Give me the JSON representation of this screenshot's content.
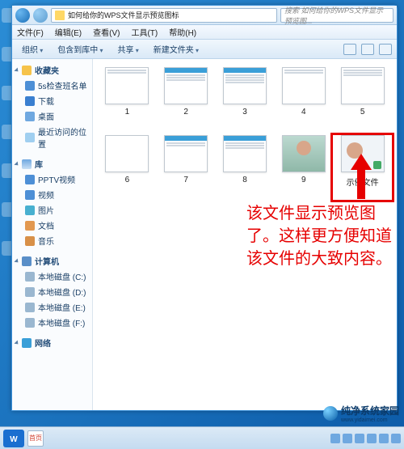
{
  "window": {
    "breadcrumb": "如何给你的WPS文件显示预览图标",
    "search_placeholder": "搜索 如何给你的WPS文件显示预览图..."
  },
  "menubar": {
    "file": "文件(F)",
    "edit": "编辑(E)",
    "view": "查看(V)",
    "tools": "工具(T)",
    "help": "帮助(H)"
  },
  "toolbar": {
    "organize": "组织",
    "include": "包含到库中",
    "share": "共享",
    "newfolder": "新建文件夹"
  },
  "sidebar": {
    "favorites": {
      "label": "收藏夹"
    },
    "fav_items": [
      {
        "label": "5s检查班名单"
      },
      {
        "label": "下载"
      },
      {
        "label": "桌面"
      },
      {
        "label": "最近访问的位置"
      }
    ],
    "libraries": {
      "label": "库"
    },
    "lib_items": [
      {
        "label": "PPTV视频"
      },
      {
        "label": "视频"
      },
      {
        "label": "图片"
      },
      {
        "label": "文档"
      },
      {
        "label": "音乐"
      }
    ],
    "computer": {
      "label": "计算机"
    },
    "comp_items": [
      {
        "label": "本地磁盘 (C:)"
      },
      {
        "label": "本地磁盘 (D:)"
      },
      {
        "label": "本地磁盘 (E:)"
      },
      {
        "label": "本地磁盘 (F:)"
      }
    ],
    "network": {
      "label": "网络"
    }
  },
  "files": [
    {
      "name": "1"
    },
    {
      "name": "2"
    },
    {
      "name": "3"
    },
    {
      "name": "4"
    },
    {
      "name": "5"
    },
    {
      "name": "6"
    },
    {
      "name": "7"
    },
    {
      "name": "8"
    },
    {
      "name": "9"
    },
    {
      "name": "示例文件"
    }
  ],
  "annotation": "该文件显示预览图了。这样更方便知道该文件的大致内容。",
  "watermark": {
    "text": "纯净系统家园",
    "url": "www.yidaimei.com"
  },
  "taskbar": {
    "app": "首页"
  }
}
